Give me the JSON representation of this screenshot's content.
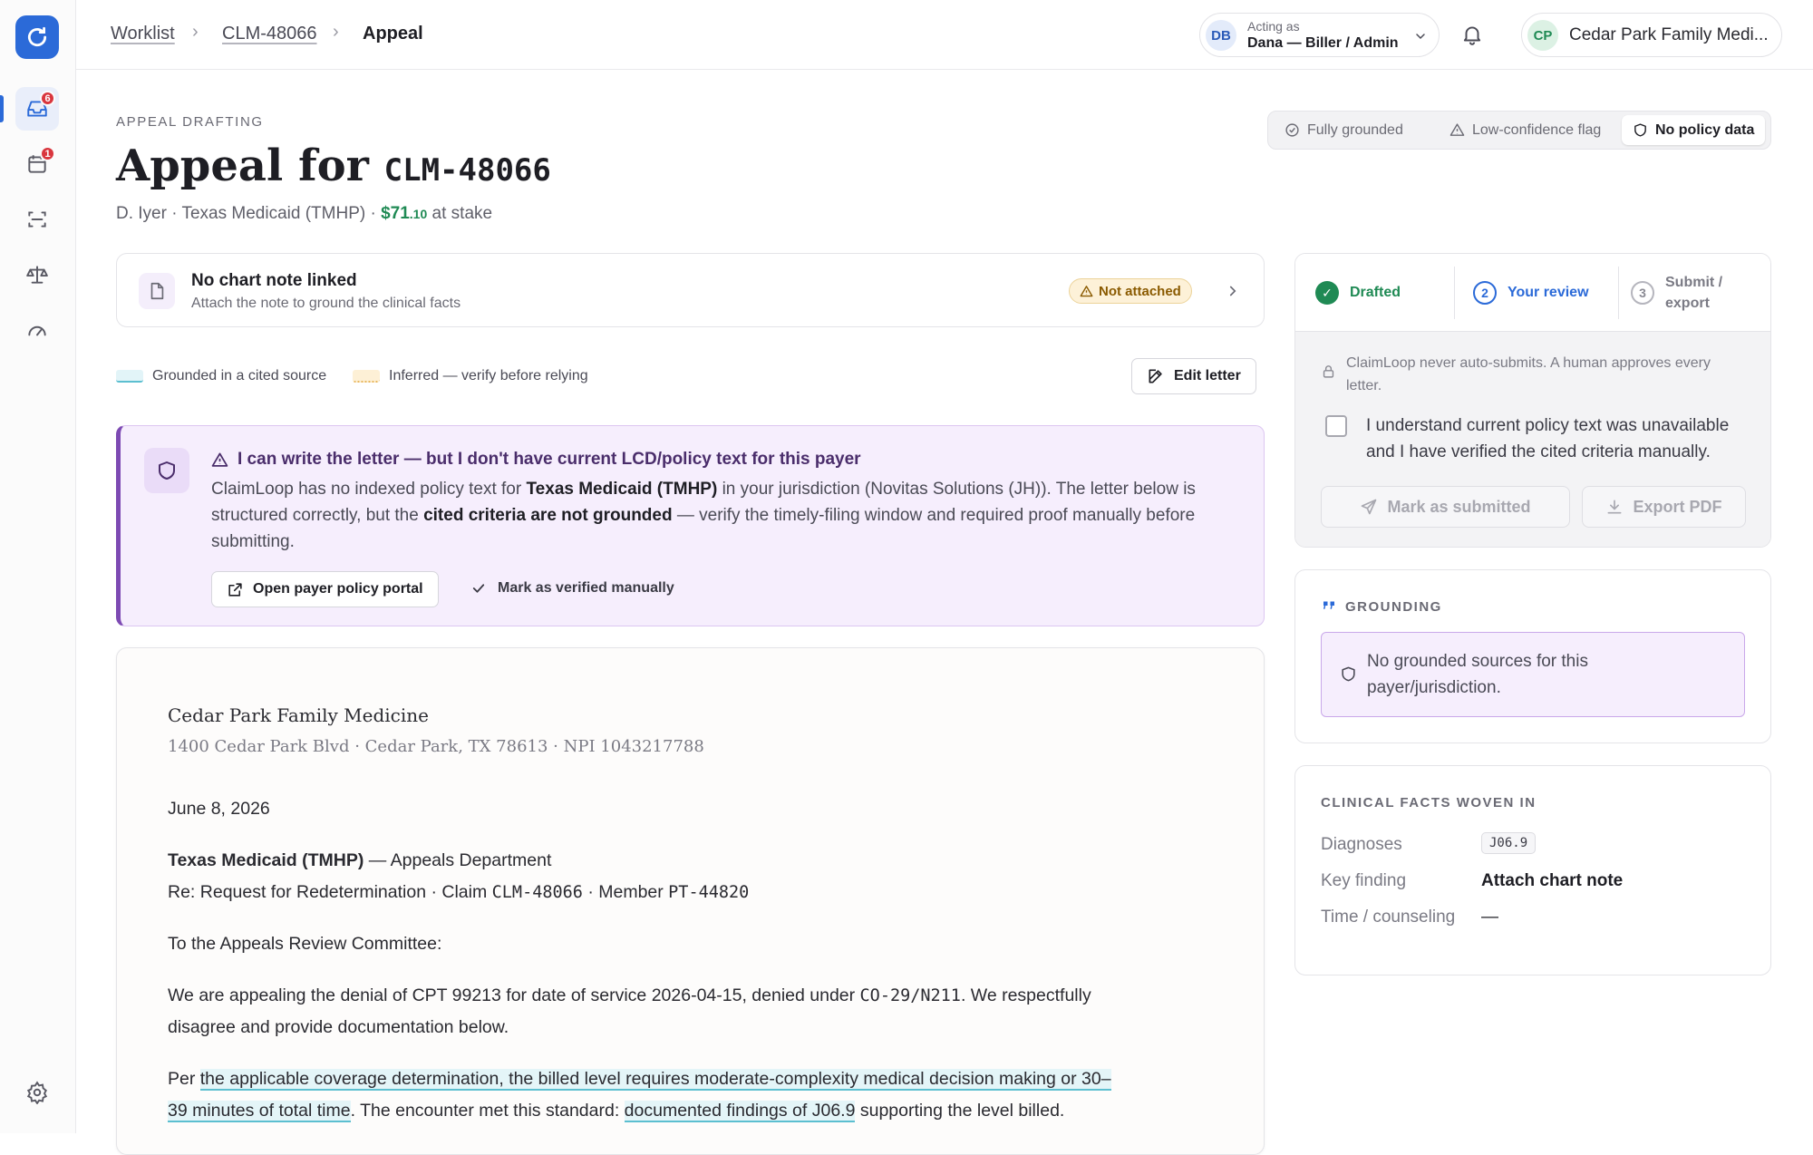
{
  "breadcrumb": {
    "items": [
      "Worklist",
      "CLM-48066"
    ],
    "current": "Appeal"
  },
  "acting": {
    "initials": "DB",
    "label": "Acting as",
    "user": "Dana — Biller / Admin"
  },
  "org": {
    "initials": "CP",
    "name": "Cedar Park Family Medi..."
  },
  "sidebar": {
    "inbox_badge": "6",
    "calendar_badge": "1"
  },
  "header": {
    "eyebrow": "APPEAL DRAFTING",
    "title_prefix": "Appeal for",
    "title_claim": "CLM-48066",
    "sub_prefix": "D. Iyer · Texas Medicaid (TMHP) ·",
    "amount_whole": "$71",
    "amount_cents": ".10",
    "sub_suffix": "at stake"
  },
  "view_modes": {
    "items": [
      "Fully grounded",
      "Low-confidence flag",
      "No policy data"
    ],
    "selected": "No policy data"
  },
  "chart_note": {
    "title": "No chart note linked",
    "subtitle": "Attach the note to ground the clinical facts",
    "status": "Not attached"
  },
  "legend": {
    "grounded": "Grounded in a cited source",
    "inferred": "Inferred — verify before relying"
  },
  "edit_letter": "Edit letter",
  "alert": {
    "title": "I can write the letter — but I don't have current LCD/policy text for this payer",
    "body_1": "ClaimLoop has no indexed policy text for ",
    "body_payer": "Texas Medicaid (TMHP)",
    "body_2": " in your jurisdiction (Novitas Solutions (JH)). The letter below is structured correctly, but the ",
    "body_bold": "cited criteria are not grounded",
    "body_3": " — verify the timely-filing window and required proof manually before submitting.",
    "btn_portal": "Open payer policy portal",
    "btn_verified": "Mark as verified manually"
  },
  "letter": {
    "practice": "Cedar Park Family Medicine",
    "address": "1400 Cedar Park Blvd · Cedar Park, TX 78613 · NPI 1043217788",
    "date": "June 8, 2026",
    "payer": "Texas Medicaid (TMHP)",
    "payer_dept": " — Appeals Department",
    "re_prefix": "Re: Request for Redetermination · Claim ",
    "re_claim": "CLM-48066",
    "re_mid": " · Member ",
    "re_member": "PT-44820",
    "salutation": "To the Appeals Review Committee:",
    "p1_a": "We are appealing the denial of CPT 99213 for date of service 2026-04-15, denied under ",
    "p1_code": "CO-29/N211",
    "p1_b": ". We respectfully",
    "p1_c": "disagree and provide documentation below.",
    "p2_a": "Per ",
    "p2_g1a": "the applicable coverage determination, the billed level requires moderate-complexity medical decision making or 30–",
    "p2_g1b": "39 minutes of total time",
    "p2_b": ". The encounter met this standard: ",
    "p2_g2": "documented findings of J06.9",
    "p2_c": " supporting the level billed."
  },
  "steps": {
    "items": [
      {
        "num": "✓",
        "label": "Drafted"
      },
      {
        "num": "2",
        "label": "Your review"
      },
      {
        "num": "3",
        "label_1": "Submit /",
        "label_2": "export"
      }
    ],
    "notice_1": "ClaimLoop never auto-submits. A human approves every",
    "notice_2": "letter.",
    "checkbox_1": "I understand current policy text was unavailable",
    "checkbox_2": "and I have verified the cited criteria manually.",
    "submit": "Mark as submitted",
    "export": "Export PDF"
  },
  "grounding": {
    "label": "GROUNDING",
    "message_1": "No grounded sources for this",
    "message_2": "payer/jurisdiction."
  },
  "facts": {
    "label": "CLINICAL FACTS WOVEN IN",
    "rows": [
      {
        "key": "Diagnoses",
        "value": "J06.9"
      },
      {
        "key": "Key finding",
        "value": "Attach chart note"
      },
      {
        "key": "Time / counseling",
        "value": "—"
      }
    ]
  },
  "colors": {
    "accent": "#2b6ad8",
    "policy_purple": "#7d4ab3",
    "money_green": "#1f8a54",
    "grounded_cyan": "#5cbfd0",
    "inferred_amber": "#e8b860"
  }
}
